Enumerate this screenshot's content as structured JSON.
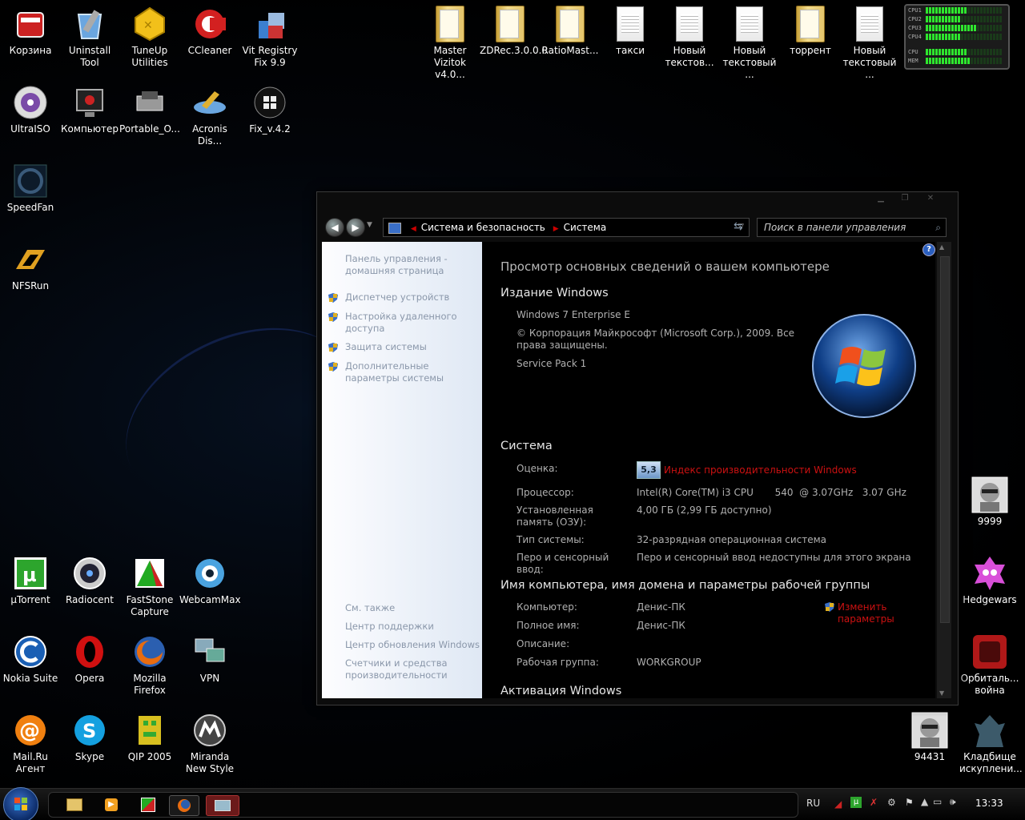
{
  "desktop": {
    "icons_left": [
      {
        "label": "Корзина",
        "icon": "recycle-bin-icon"
      },
      {
        "label": "Uninstall Tool",
        "icon": "uninstall-tool-icon"
      },
      {
        "label": "TuneUp Utilities",
        "icon": "tuneup-icon"
      },
      {
        "label": "CCleaner",
        "icon": "ccleaner-icon"
      },
      {
        "label": "Vit Registry Fix 9.9",
        "icon": "registry-fix-icon"
      },
      {
        "label": "UltraISO",
        "icon": "ultraiso-icon"
      },
      {
        "label": "Компьютер",
        "icon": "computer-icon"
      },
      {
        "label": "Portable_O...",
        "icon": "portable-icon"
      },
      {
        "label": "Acronis Dis...",
        "icon": "acronis-icon"
      },
      {
        "label": "Fix_v.4.2",
        "icon": "fix-icon"
      },
      {
        "label": "SpeedFan",
        "icon": "speedfan-icon"
      },
      {
        "label": "NFSRun",
        "icon": "nfs-icon"
      },
      {
        "label": "µTorrent",
        "icon": "utorrent-icon"
      },
      {
        "label": "Radiocent",
        "icon": "radiocent-icon"
      },
      {
        "label": "FastStone Capture",
        "icon": "faststone-icon"
      },
      {
        "label": "WebcamMax",
        "icon": "webcam-icon"
      },
      {
        "label": "Nokia Suite",
        "icon": "nokia-icon"
      },
      {
        "label": "Opera",
        "icon": "opera-icon"
      },
      {
        "label": "Mozilla Firefox",
        "icon": "firefox-icon"
      },
      {
        "label": "VPN",
        "icon": "vpn-icon"
      },
      {
        "label": "Mail.Ru Агент",
        "icon": "mailru-icon"
      },
      {
        "label": "Skype",
        "icon": "skype-icon"
      },
      {
        "label": "QIP 2005",
        "icon": "qip-icon"
      },
      {
        "label": "Miranda New Style",
        "icon": "miranda-icon"
      }
    ],
    "icons_top": [
      {
        "label": "Master Vizitok v4.0...",
        "type": "folder"
      },
      {
        "label": "ZDRec.3.0.0.0",
        "type": "folder"
      },
      {
        "label": "RatioMast...",
        "type": "folder"
      },
      {
        "label": "такси",
        "type": "doc"
      },
      {
        "label": "Новый текстов...",
        "type": "doc"
      },
      {
        "label": "Новый текстовый ...",
        "type": "doc"
      },
      {
        "label": "торрент",
        "type": "folder"
      },
      {
        "label": "Новый текстовый ...",
        "type": "doc"
      }
    ],
    "icons_right": [
      {
        "label": "9999",
        "icon": "photo-icon"
      },
      {
        "label": "Hedgewars",
        "icon": "hedgewars-icon"
      },
      {
        "label": "Орбиталь... война",
        "icon": "orbital-icon"
      },
      {
        "label": "94431",
        "icon": "photo-icon"
      },
      {
        "label": "Кладбище искуплени...",
        "icon": "gargoyle-icon"
      }
    ]
  },
  "gadget": {
    "rows": [
      {
        "label": "CPU1",
        "level": 0.55
      },
      {
        "label": "CPU2",
        "level": 0.45
      },
      {
        "label": "CPU3",
        "level": 0.65
      },
      {
        "label": "CPU4",
        "level": 0.45
      },
      {
        "label": "CPU",
        "level": 0.55
      },
      {
        "label": "MEM",
        "level": 0.6
      }
    ]
  },
  "window": {
    "breadcrumb": [
      "Система и безопасность",
      "Система"
    ],
    "search_placeholder": "Поиск в панели управления",
    "sidebar": {
      "home": "Панель управления - домашняя страница",
      "links": [
        "Диспетчер устройств",
        "Настройка удаленного доступа",
        "Защита системы",
        "Дополнительные параметры системы"
      ],
      "see_also": "См. также",
      "see_links": [
        "Центр поддержки",
        "Центр обновления Windows",
        "Счетчики и средства производительности"
      ]
    },
    "content": {
      "heading": "Просмотр основных сведений о вашем компьютере",
      "edition_title": "Издание Windows",
      "edition": "Windows 7 Enterprise E",
      "copyright": "© Корпорация Майкрософт (Microsoft Corp.), 2009. Все права защищены.",
      "service_pack": "Service Pack 1",
      "system_title": "Система",
      "rating_label": "Оценка:",
      "rating_value": "5,3",
      "rating_link": "Индекс производительности Windows",
      "cpu_label": "Процессор:",
      "cpu_value": "Intel(R) Core(TM) i3 CPU       540  @ 3.07GHz   3.07 GHz",
      "ram_label": "Установленная память (ОЗУ):",
      "ram_value": "4,00 ГБ (2,99 ГБ доступно)",
      "type_label": "Тип системы:",
      "type_value": "32-разрядная операционная система",
      "pen_label": "Перо и сенсорный ввод:",
      "pen_value": "Перо и сенсорный ввод недоступны для этого экрана",
      "name_title": "Имя компьютера, имя домена и параметры рабочей группы",
      "computer_label": "Компьютер:",
      "computer_value": "Денис-ПК",
      "change_link": "Изменить параметры",
      "fullname_label": "Полное имя:",
      "fullname_value": "Денис-ПК",
      "desc_label": "Описание:",
      "workgroup_label": "Рабочая группа:",
      "workgroup_value": "WORKGROUP",
      "activation_title": "Активация Windows"
    }
  },
  "taskbar": {
    "lang": "RU",
    "time": "13:33"
  },
  "colors": {
    "link_red": "#cc1111",
    "sidebar_link": "#8a97aa",
    "gadget_green": "#2ee62e"
  }
}
